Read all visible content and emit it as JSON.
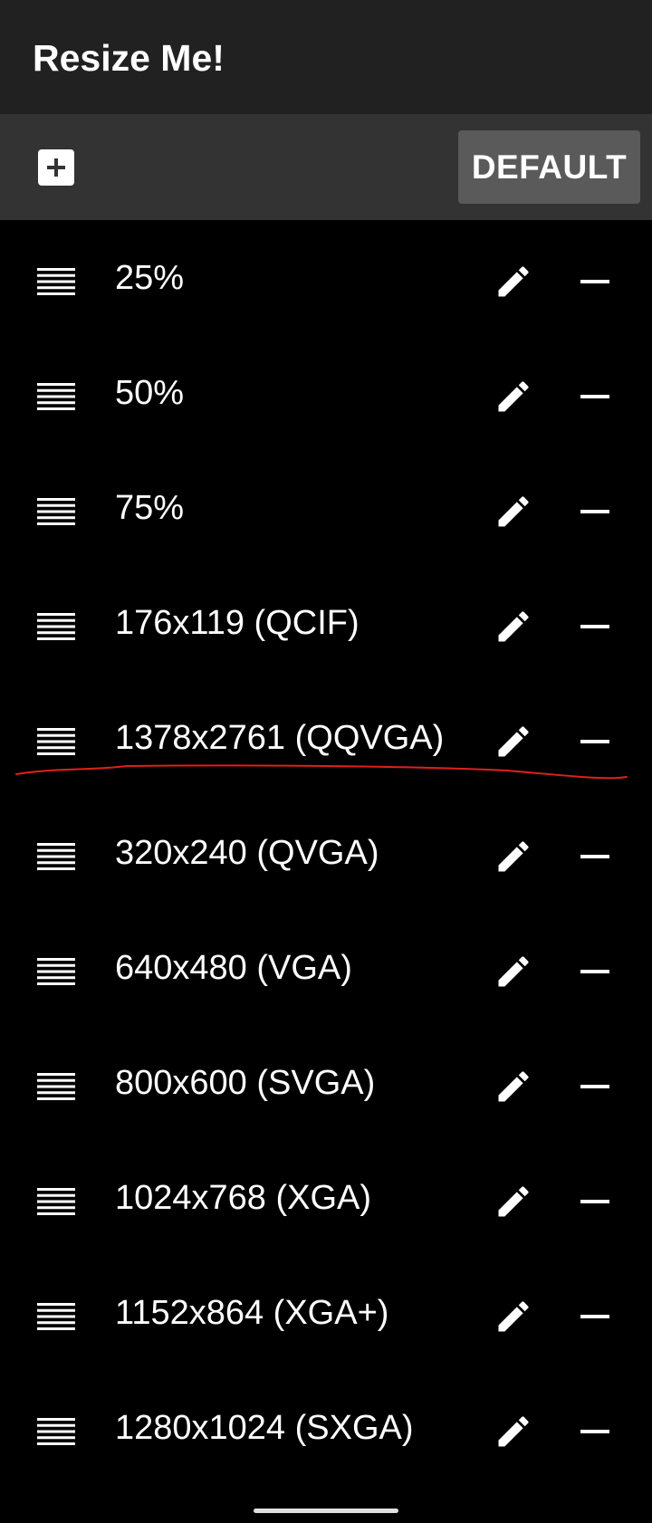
{
  "app_bar": {
    "title": "Resize Me!"
  },
  "toolbar": {
    "add_icon": "plus-box-icon",
    "default_label": "DEFAULT"
  },
  "list": {
    "items": [
      {
        "label": "25%"
      },
      {
        "label": "50%"
      },
      {
        "label": "75%"
      },
      {
        "label": "176x119 (QCIF)"
      },
      {
        "label": "1378x2761 (QQVGA)"
      },
      {
        "label": "320x240 (QVGA)"
      },
      {
        "label": "640x480 (VGA)"
      },
      {
        "label": "800x600 (SVGA)"
      },
      {
        "label": "1024x768 (XGA)"
      },
      {
        "label": "1152x864 (XGA+)"
      },
      {
        "label": "1280x1024 (SXGA)"
      }
    ],
    "row_icons": {
      "drag": "drag-handle-icon",
      "edit": "pencil-icon",
      "remove": "minus-icon"
    }
  },
  "colors": {
    "background": "#000000",
    "app_bar": "#212121",
    "toolbar": "#333333",
    "default_button": "#5a5a5a",
    "text": "#ffffff",
    "annotation": "#e0201c"
  }
}
